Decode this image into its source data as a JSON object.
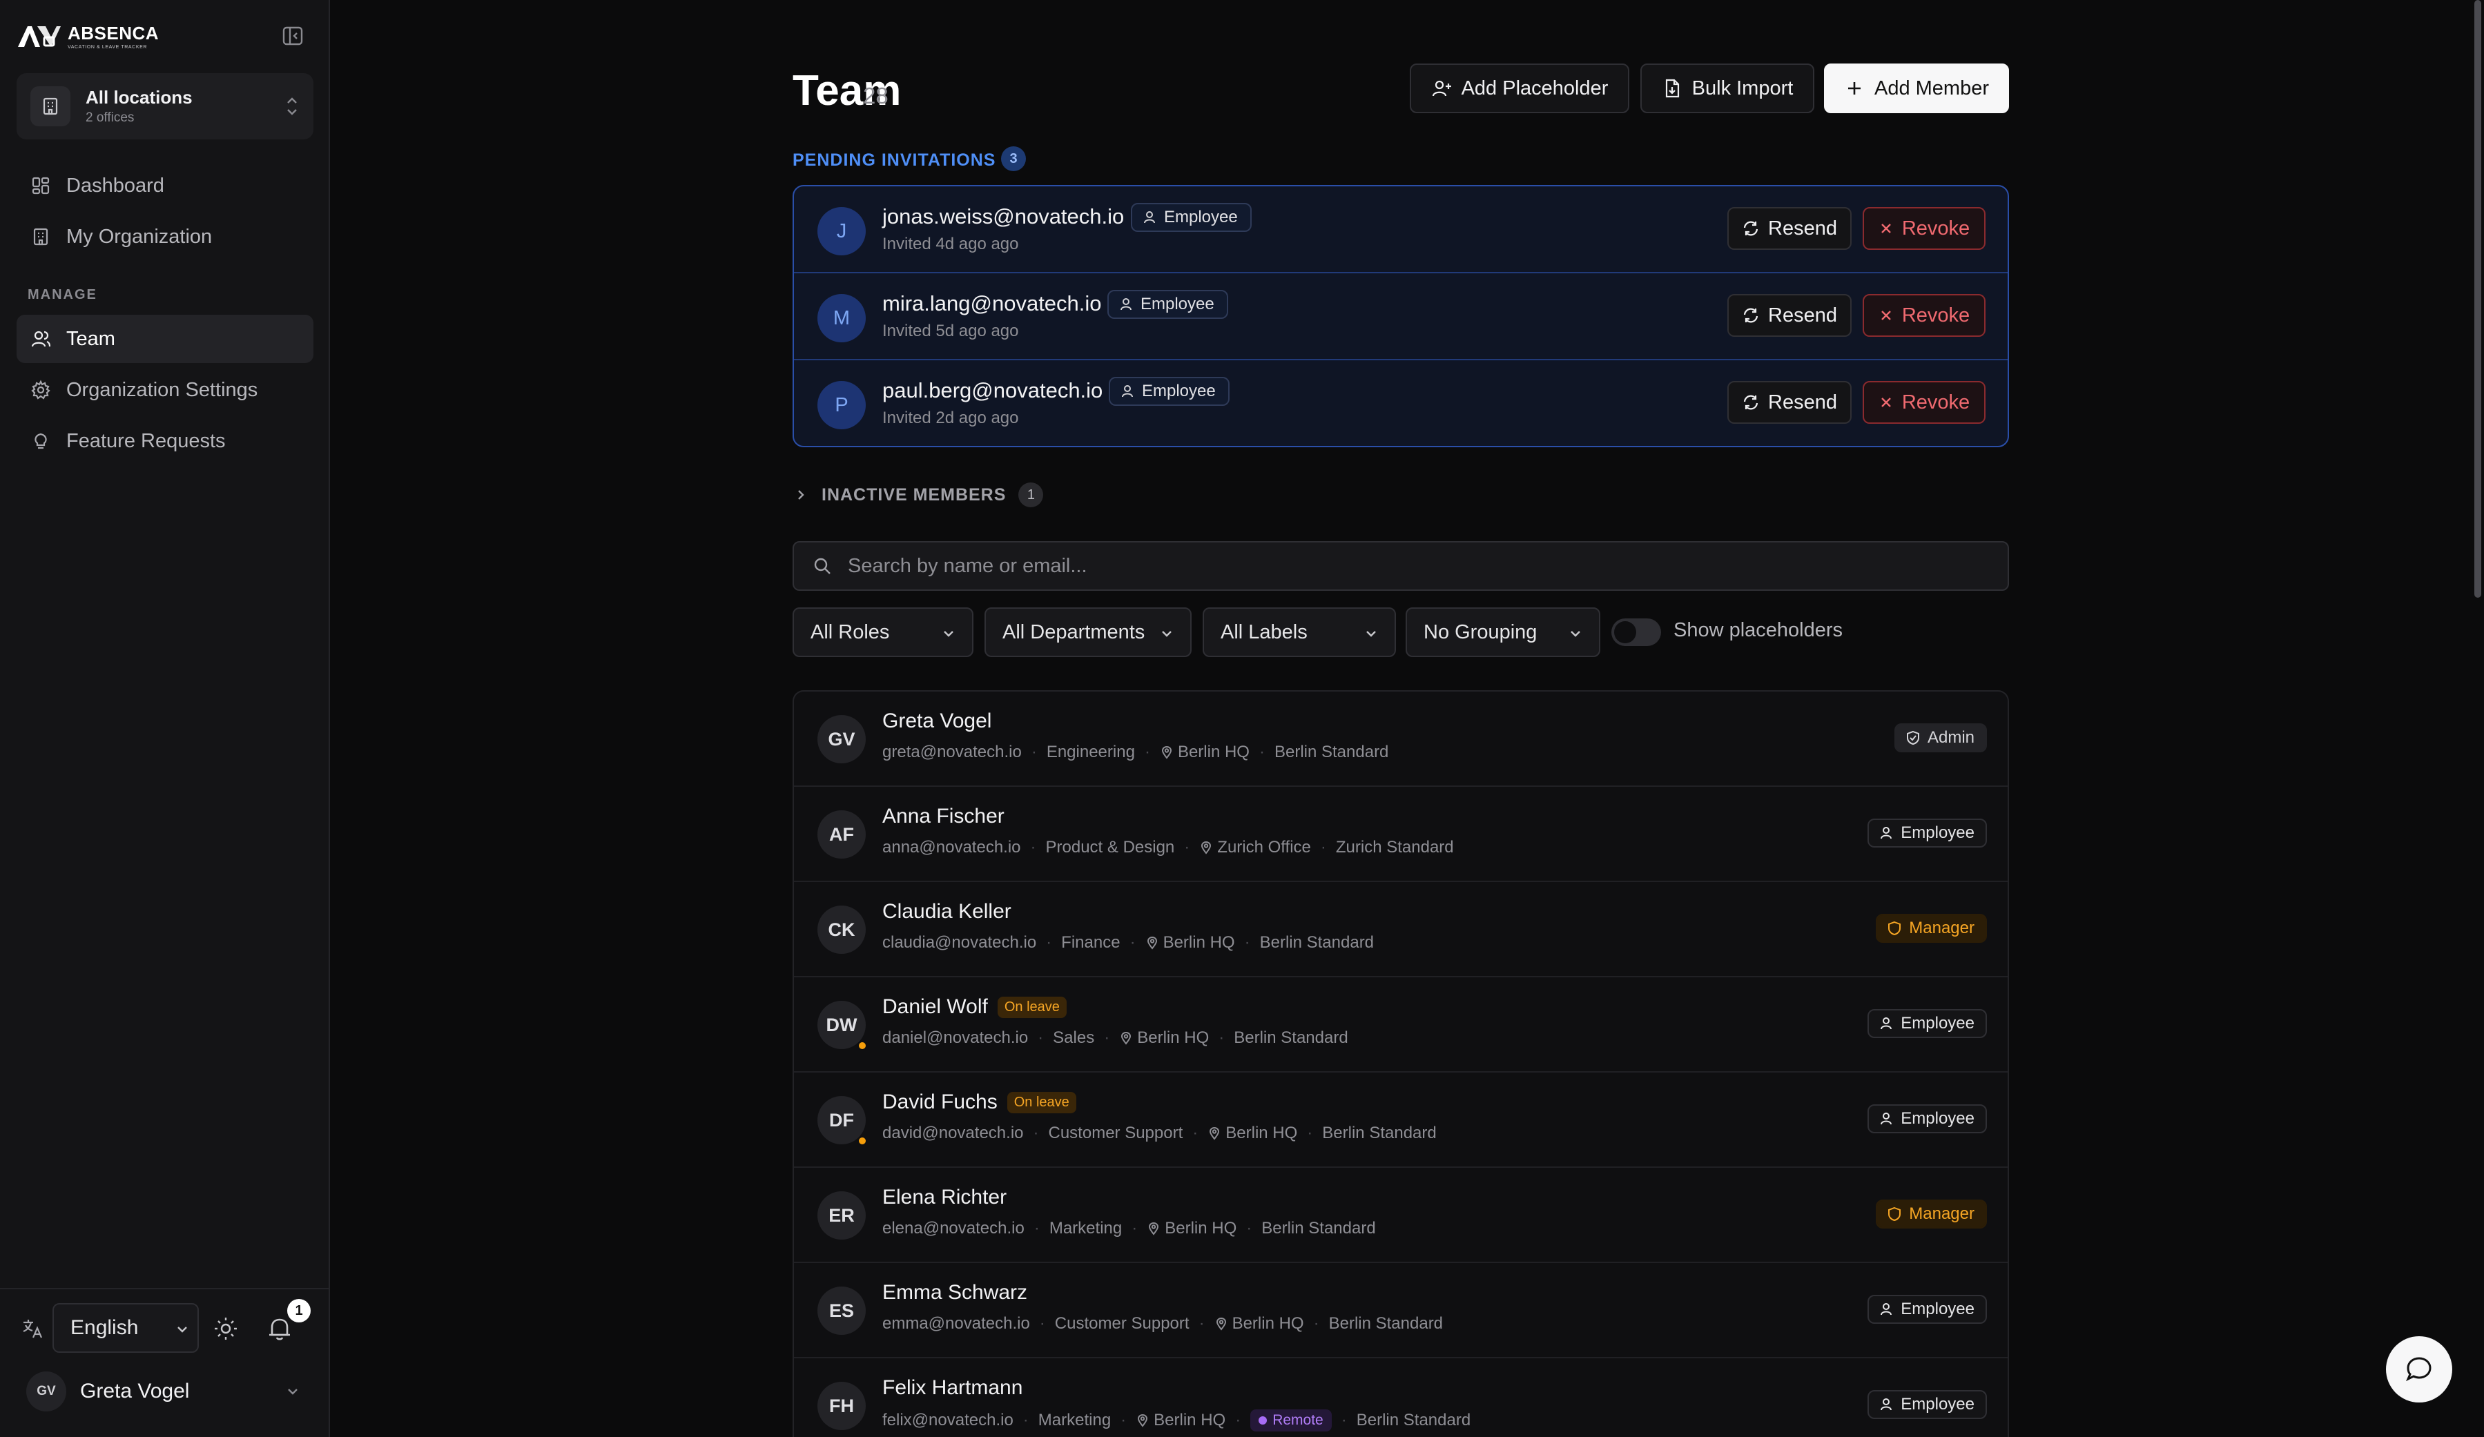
{
  "app": {
    "brand_name": "ABSENCA",
    "brand_tagline": "VACATION & LEAVE TRACKER"
  },
  "sidebar": {
    "location": {
      "title": "All locations",
      "subtitle": "2 offices"
    },
    "nav": [
      {
        "label": "Dashboard",
        "icon": "dashboard-icon"
      },
      {
        "label": "My Organization",
        "icon": "building-icon"
      }
    ],
    "section_label": "MANAGE",
    "manage": [
      {
        "label": "Team",
        "icon": "users-icon",
        "active": true
      },
      {
        "label": "Organization Settings",
        "icon": "gear-icon"
      },
      {
        "label": "Feature Requests",
        "icon": "lightbulb-icon"
      }
    ],
    "language": "English",
    "notifications_count": "1",
    "user": {
      "initials": "GV",
      "name": "Greta Vogel"
    }
  },
  "header": {
    "title": "Team",
    "count": "28",
    "add_placeholder_label": "Add Placeholder",
    "bulk_import_label": "Bulk Import",
    "add_member_label": "Add Member"
  },
  "pending": {
    "label": "PENDING INVITATIONS",
    "count": "3",
    "resend_label": "Resend",
    "revoke_label": "Revoke",
    "invitations": [
      {
        "initial": "J",
        "email": "jonas.weiss@novatech.io",
        "role": "Employee",
        "invited": "Invited 4d ago ago"
      },
      {
        "initial": "M",
        "email": "mira.lang@novatech.io",
        "role": "Employee",
        "invited": "Invited 5d ago ago"
      },
      {
        "initial": "P",
        "email": "paul.berg@novatech.io",
        "role": "Employee",
        "invited": "Invited 2d ago ago"
      }
    ]
  },
  "inactive": {
    "label": "INACTIVE MEMBERS",
    "count": "1"
  },
  "search": {
    "placeholder": "Search by name or email..."
  },
  "filters": {
    "roles": "All Roles",
    "departments": "All Departments",
    "labels": "All Labels",
    "grouping": "No Grouping",
    "show_placeholders_label": "Show placeholders"
  },
  "members": [
    {
      "initials": "GV",
      "name": "Greta Vogel",
      "on_leave": false,
      "email": "greta@novatech.io",
      "department": "Engineering",
      "location": "Berlin HQ",
      "remote": false,
      "policy": "Berlin Standard",
      "role": "Admin",
      "role_type": "admin"
    },
    {
      "initials": "AF",
      "name": "Anna Fischer",
      "on_leave": false,
      "email": "anna@novatech.io",
      "department": "Product & Design",
      "location": "Zurich Office",
      "remote": false,
      "policy": "Zurich Standard",
      "role": "Employee",
      "role_type": "employee"
    },
    {
      "initials": "CK",
      "name": "Claudia Keller",
      "on_leave": false,
      "email": "claudia@novatech.io",
      "department": "Finance",
      "location": "Berlin HQ",
      "remote": false,
      "policy": "Berlin Standard",
      "role": "Manager",
      "role_type": "manager"
    },
    {
      "initials": "DW",
      "name": "Daniel Wolf",
      "on_leave": true,
      "email": "daniel@novatech.io",
      "department": "Sales",
      "location": "Berlin HQ",
      "remote": false,
      "policy": "Berlin Standard",
      "role": "Employee",
      "role_type": "employee"
    },
    {
      "initials": "DF",
      "name": "David Fuchs",
      "on_leave": true,
      "email": "david@novatech.io",
      "department": "Customer Support",
      "location": "Berlin HQ",
      "remote": false,
      "policy": "Berlin Standard",
      "role": "Employee",
      "role_type": "employee"
    },
    {
      "initials": "ER",
      "name": "Elena Richter",
      "on_leave": false,
      "email": "elena@novatech.io",
      "department": "Marketing",
      "location": "Berlin HQ",
      "remote": false,
      "policy": "Berlin Standard",
      "role": "Manager",
      "role_type": "manager"
    },
    {
      "initials": "ES",
      "name": "Emma Schwarz",
      "on_leave": false,
      "email": "emma@novatech.io",
      "department": "Customer Support",
      "location": "Berlin HQ",
      "remote": false,
      "policy": "Berlin Standard",
      "role": "Employee",
      "role_type": "employee"
    },
    {
      "initials": "FH",
      "name": "Felix Hartmann",
      "on_leave": false,
      "email": "felix@novatech.io",
      "department": "Marketing",
      "location": "Berlin HQ",
      "remote": true,
      "policy": "Berlin Standard",
      "role": "Employee",
      "role_type": "employee"
    }
  ],
  "labels": {
    "on_leave": "On leave",
    "remote": "Remote"
  },
  "colors": {
    "accent_blue": "#4f8ff7",
    "danger": "#f06a70",
    "warning": "#f5a524",
    "remote_purple": "#a76cf6"
  }
}
